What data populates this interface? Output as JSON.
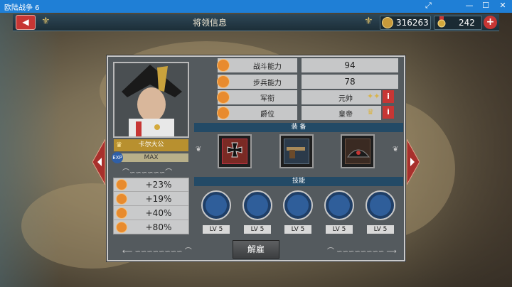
{
  "window": {
    "title": "欧陆战争 6"
  },
  "header": {
    "title": "将领信息",
    "coins": "316263",
    "medals": "242",
    "back_icon": "back-arrow-icon",
    "plus_icon": "plus-icon"
  },
  "general": {
    "name": "卡尔大公",
    "xp_label": "EXP",
    "xp_value": "MAX"
  },
  "bonuses": [
    "+23%",
    "+19%",
    "+40%",
    "+80%"
  ],
  "stats": [
    {
      "label": "战斗能力",
      "value": "94"
    },
    {
      "label": "步兵能力",
      "value": "78"
    },
    {
      "label": "军衔",
      "value": "元帅"
    },
    {
      "label": "爵位",
      "value": "皇帝"
    }
  ],
  "info_label": "i",
  "sections": {
    "equipment": "装 备",
    "skills": "技能"
  },
  "skills": [
    {
      "level": "LV 5"
    },
    {
      "level": "LV 5"
    },
    {
      "level": "LV 5"
    },
    {
      "level": "LV 5"
    },
    {
      "level": "LV 5"
    }
  ],
  "actions": {
    "dismiss": "解雇"
  },
  "colors": {
    "accent_red": "#c73634",
    "header_blue": "#234a66",
    "gold": "#b8902f",
    "orange_icon": "#e88b2e"
  }
}
